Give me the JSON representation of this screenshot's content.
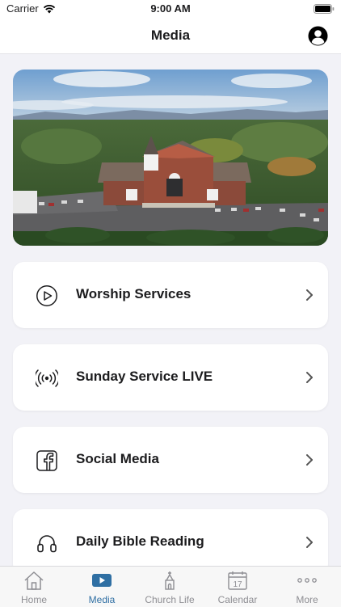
{
  "status_bar": {
    "carrier": "Carrier",
    "time": "9:00 AM"
  },
  "nav": {
    "title": "Media",
    "profile_icon": "person-circle-icon"
  },
  "hero": {
    "image": "church-aerial-photo"
  },
  "items": [
    {
      "label": "Worship Services",
      "icon": "play-circle-icon"
    },
    {
      "label": "Sunday Service LIVE",
      "icon": "broadcast-icon"
    },
    {
      "label": "Social Media",
      "icon": "facebook-icon"
    },
    {
      "label": "Daily Bible Reading",
      "icon": "headphones-icon"
    }
  ],
  "tabs": [
    {
      "label": "Home",
      "icon": "home-icon",
      "active": false
    },
    {
      "label": "Media",
      "icon": "video-icon",
      "active": true
    },
    {
      "label": "Church Life",
      "icon": "church-icon",
      "active": false
    },
    {
      "label": "Calendar",
      "icon": "calendar-icon",
      "active": false,
      "day": "17"
    },
    {
      "label": "More",
      "icon": "more-dots-icon",
      "active": false
    }
  ],
  "colors": {
    "accent": "#2f6fa3",
    "inactive": "#8e8e93",
    "background": "#f2f2f7"
  }
}
